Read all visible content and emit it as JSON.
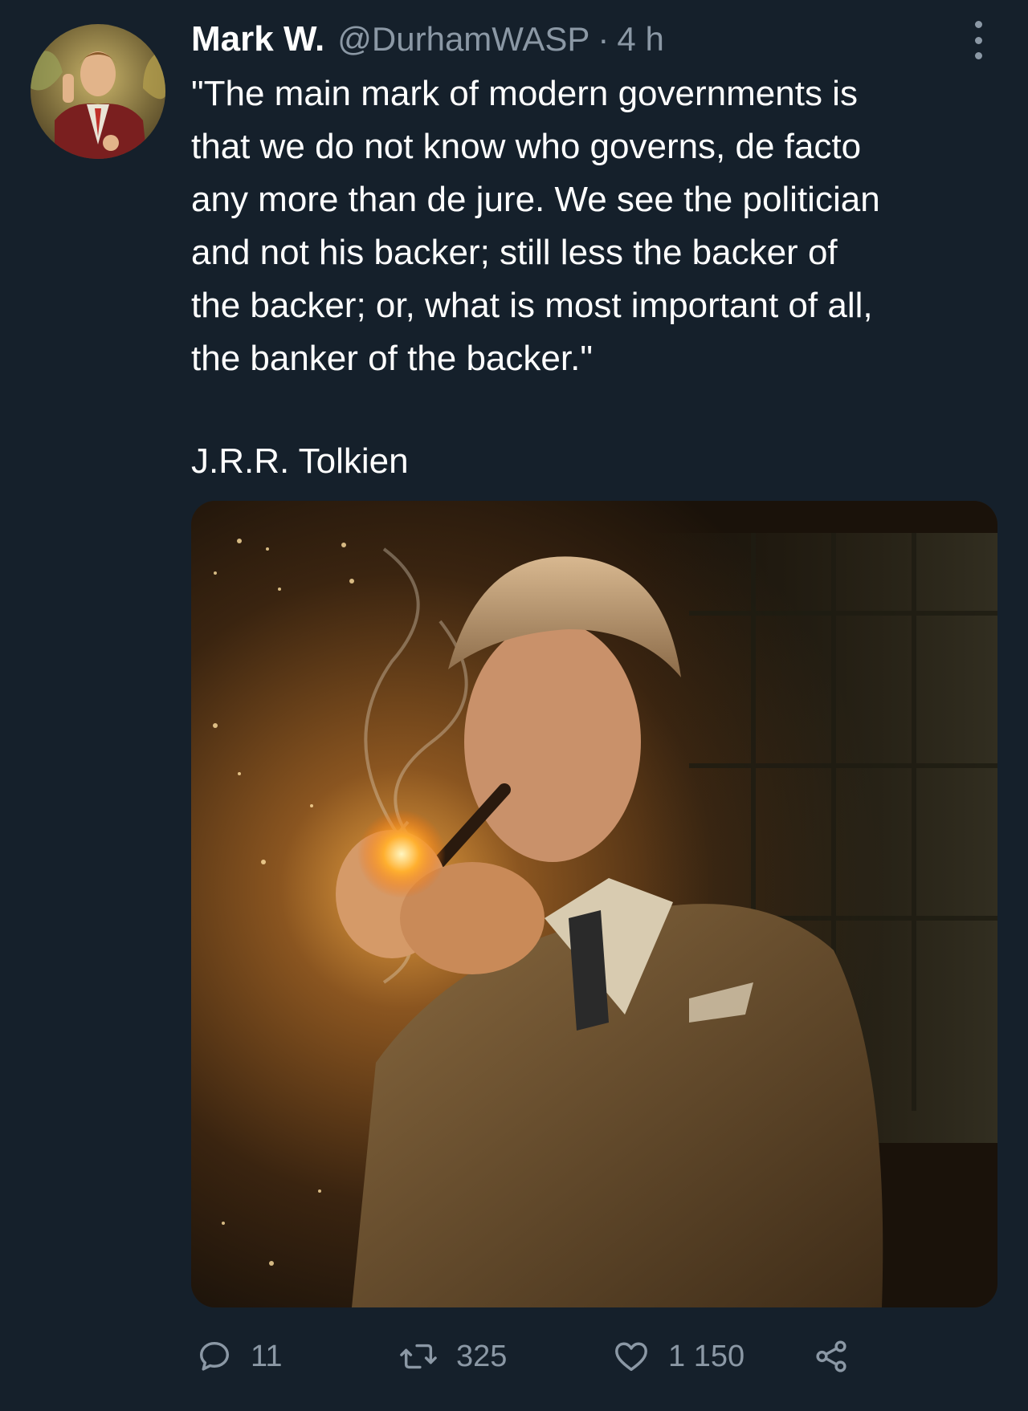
{
  "author": {
    "display_name": "Mark W.",
    "handle": "@DurhamWASP",
    "separator": "·",
    "time": "4 h"
  },
  "tweet": {
    "lines": [
      "\"The main mark of modern governments is",
      "that we do not know who governs, de facto",
      "any more than de jure. We see the politician",
      "and not his backer; still less the backer of",
      "the backer; or, what is most important of all,",
      "the banker of the backer.\""
    ],
    "attribution": "J.R.R. Tolkien"
  },
  "actions": {
    "reply_count": "11",
    "retweet_count": "325",
    "like_count": "1 150"
  },
  "icons": {
    "more": "more-vertical-icon",
    "reply": "reply-bubble-icon",
    "retweet": "retweet-icon",
    "like": "heart-icon",
    "share": "share-icon"
  },
  "colors": {
    "background": "#15202b",
    "primary_text": "#ffffff",
    "secondary_text": "#8b98a5"
  }
}
